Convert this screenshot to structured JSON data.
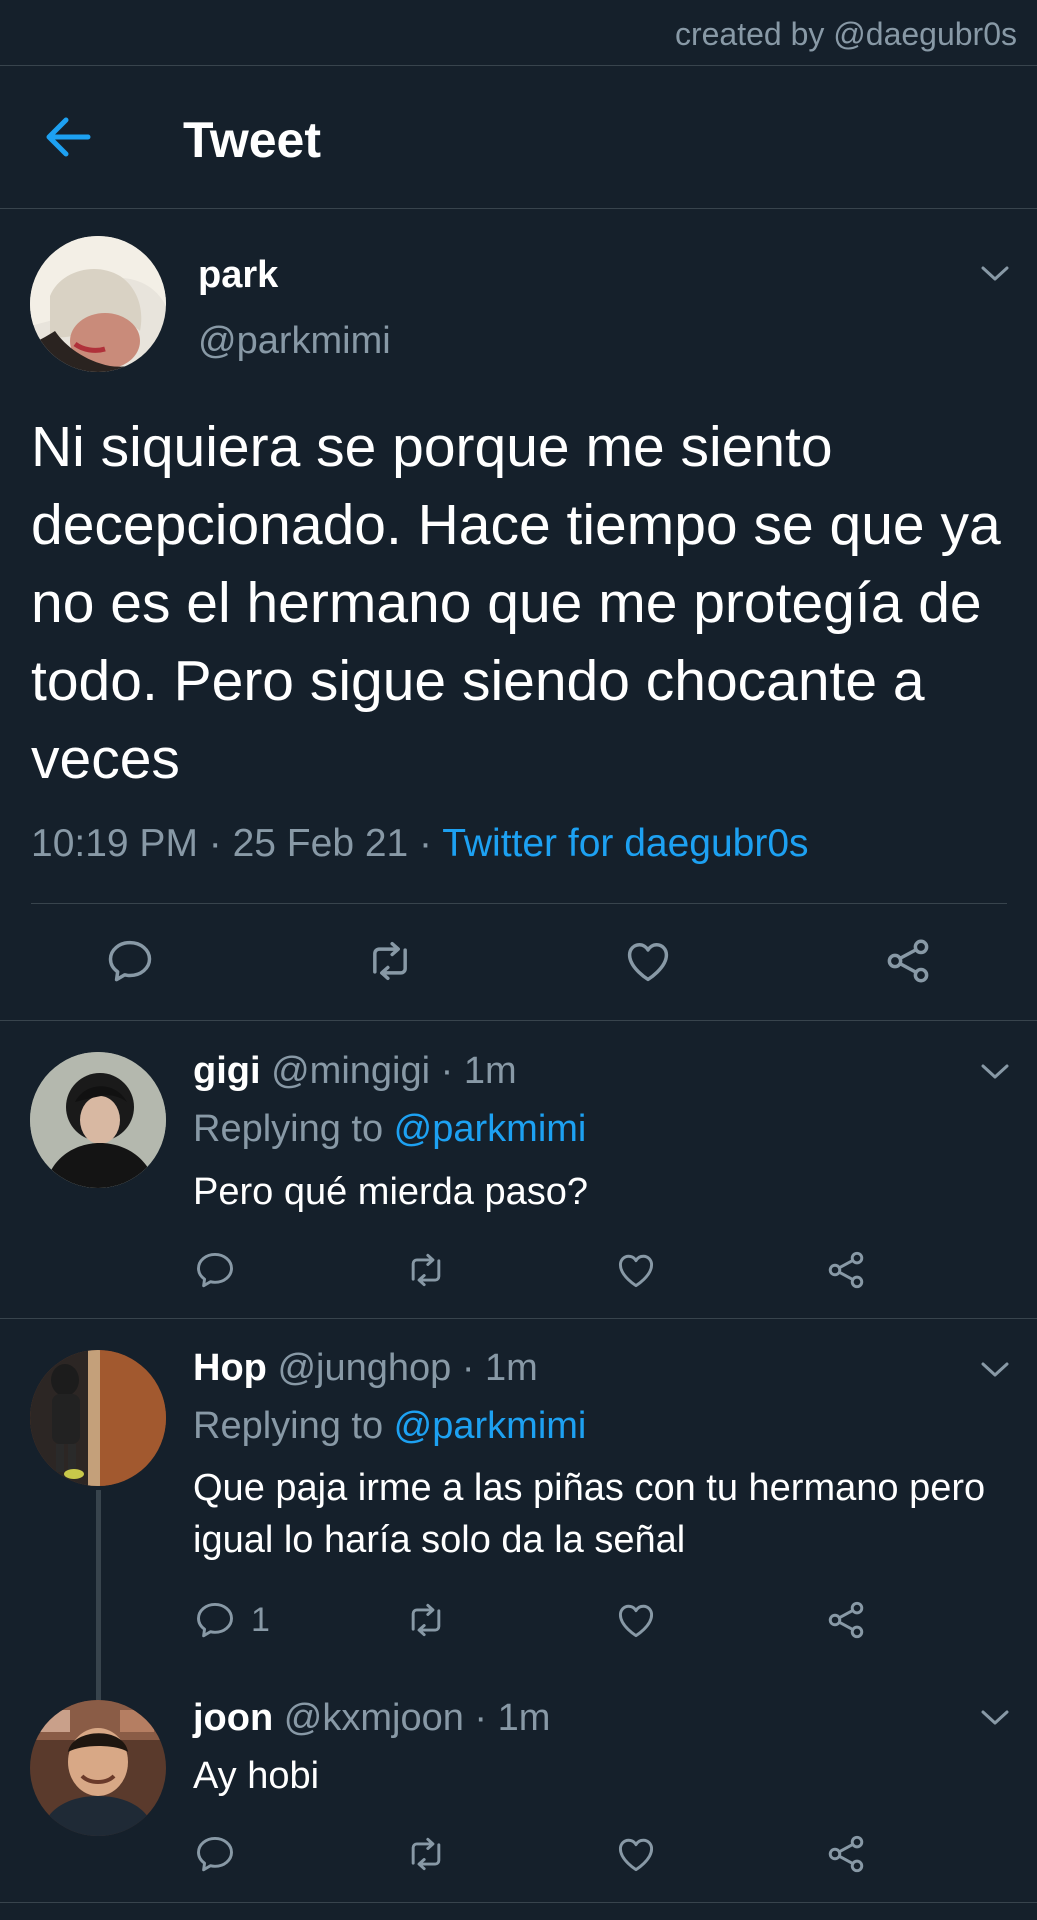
{
  "watermark": "created by @daegubr0s",
  "header": {
    "title": "Tweet"
  },
  "main_tweet": {
    "name": "park",
    "handle": "@parkmimi",
    "text": "Ni siquiera se porque me siento decepcionado. Hace tiempo se que ya no es el hermano que me protegía de todo. Pero sigue siendo chocante a veces",
    "timestamp": "10:19 PM · 25 Feb 21 · ",
    "source": "Twitter for daegubr0s"
  },
  "replies": [
    {
      "name": "gigi",
      "handle": "@mingigi",
      "time": " · 1m",
      "replying_label": "Replying to ",
      "replying_to": "@parkmimi",
      "text": "Pero qué mierda paso?",
      "reply_count": ""
    },
    {
      "name": "Hop",
      "handle": "@junghop",
      "time": " · 1m",
      "replying_label": "Replying to ",
      "replying_to": "@parkmimi",
      "text": "Que paja irme a las piñas con tu hermano pero igual lo haría solo da la señal",
      "reply_count": "1"
    },
    {
      "name": "joon",
      "handle": "@kxmjoon",
      "time": " · 1m",
      "text": "Ay hobi",
      "reply_count": ""
    }
  ],
  "colors": {
    "background": "#15202b",
    "divider": "#38444d",
    "secondary_text": "#8899a6",
    "accent": "#1da1f2"
  },
  "icons": [
    "back-arrow-icon",
    "chevron-down-icon",
    "reply-icon",
    "retweet-icon",
    "like-icon",
    "share-icon"
  ]
}
